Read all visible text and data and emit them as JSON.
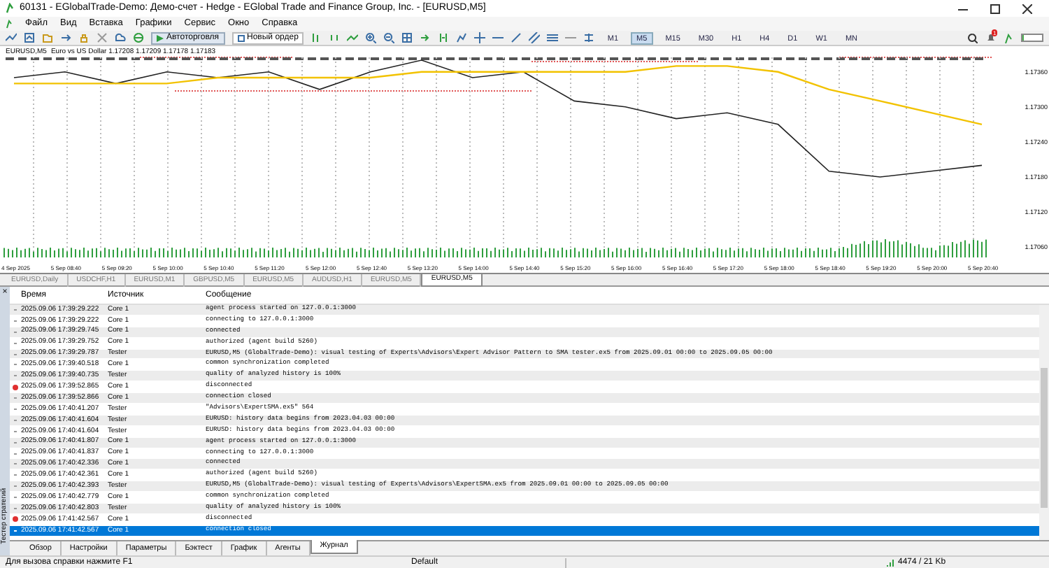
{
  "window": {
    "title": "60131 - EGlobalTrade-Demo: Демо-счет - Hedge - EGlobal Trade and Finance Group, Inc. - [EURUSD,M5]"
  },
  "menu": [
    "Файл",
    "Вид",
    "Вставка",
    "Графики",
    "Сервис",
    "Окно",
    "Справка"
  ],
  "toolbar": {
    "autotrading": "Автоторговля",
    "new_order": "Новый ордер",
    "timeframes": [
      {
        "label": "M1",
        "selected": false
      },
      {
        "label": "M5",
        "selected": true
      },
      {
        "label": "M15",
        "selected": false
      },
      {
        "label": "M30",
        "selected": false
      },
      {
        "label": "H1",
        "selected": false
      },
      {
        "label": "H4",
        "selected": false
      },
      {
        "label": "D1",
        "selected": false
      },
      {
        "label": "W1",
        "selected": false
      },
      {
        "label": "MN",
        "selected": false
      }
    ],
    "notifications": "1",
    "progress": {
      "level": 0.1
    }
  },
  "chart": {
    "header": "Euro vs US Dollar  1.17208 1.17209 1.17178 1.17183",
    "chart_data": {
      "type": "line",
      "grid": true,
      "categories": [
        "4 Sep 2025",
        "5 Sep 08:40",
        "5 Sep 09:20",
        "5 Sep 10:00",
        "5 Sep 10:40",
        "5 Sep 11:20",
        "5 Sep 12:00",
        "5 Sep 12:40",
        "5 Sep 13:20",
        "5 Sep 14:00",
        "5 Sep 14:40",
        "5 Sep 15:20",
        "5 Sep 16:00",
        "5 Sep 16:40",
        "5 Sep 17:20",
        "5 Sep 18:00",
        "5 Sep 18:40",
        "5 Sep 19:20",
        "5 Sep 20:00",
        "5 Sep 20:40"
      ],
      "ylim": [
        1.1704,
        1.1738
      ],
      "yticks": [
        {
          "value": 1.1736,
          "label": "1.17360"
        },
        {
          "value": 1.173,
          "label": "1.17300"
        },
        {
          "value": 1.1724,
          "label": "1.17240"
        },
        {
          "value": 1.1718,
          "label": "1.17180"
        },
        {
          "value": 1.1712,
          "label": "1.17120"
        },
        {
          "value": 1.1706,
          "label": "1.17060"
        }
      ],
      "series": [
        {
          "name": "EURUSD,M5",
          "color": "#222222",
          "values": [
            1.1735,
            1.1736,
            1.1734,
            1.1736,
            1.1735,
            1.1736,
            1.1733,
            1.1736,
            1.1738,
            1.1735,
            1.1736,
            1.1731,
            1.173,
            1.1728,
            1.1729,
            1.1727,
            1.1719,
            1.1718,
            1.1719,
            1.172
          ]
        },
        {
          "color": "#f2c200",
          "values": [
            1.1734,
            1.1734,
            1.1734,
            1.1734,
            1.1735,
            1.1735,
            1.1735,
            1.1735,
            1.1736,
            1.1736,
            1.1736,
            1.1736,
            1.1736,
            1.1737,
            1.1737,
            1.1736,
            1.1733,
            1.1731,
            1.1729,
            1.1727
          ]
        }
      ]
    }
  },
  "chart_tabs": [
    {
      "label": "EURUSD,Daily",
      "selected": false
    },
    {
      "label": "USDCHF,H1",
      "selected": false
    },
    {
      "label": "EURUSD,M1",
      "selected": false
    },
    {
      "label": "GBPUSD,M5",
      "selected": false
    },
    {
      "label": "EURUSD,M5",
      "selected": false
    },
    {
      "label": "AUDUSD,H1",
      "selected": false
    },
    {
      "label": "EURUSD,M5",
      "selected": false
    },
    {
      "label": "EURUSD,M5",
      "selected": true
    }
  ],
  "journal": {
    "columns": [
      "Время",
      "Источник",
      "Сообщение"
    ],
    "rows": [
      {
        "time": "2025.09.06 17:39:29.222",
        "source": "Core 1",
        "message": "agent process started on 127.0.0.1:3000",
        "kind": "info",
        "selected": false
      },
      {
        "time": "2025.09.06 17:39:29.222",
        "source": "Core 1",
        "message": "connecting to 127.0.0.1:3000",
        "kind": "info",
        "selected": false
      },
      {
        "time": "2025.09.06 17:39:29.745",
        "source": "Core 1",
        "message": "connected",
        "kind": "info",
        "selected": false
      },
      {
        "time": "2025.09.06 17:39:29.752",
        "source": "Core 1",
        "message": "authorized (agent build 5260)",
        "kind": "info",
        "selected": false
      },
      {
        "time": "2025.09.06 17:39:29.787",
        "source": "Tester",
        "message": "EURUSD,M5 (GlobalTrade-Demo): visual testing of Experts\\Advisors\\Expert Advisor Pattern to SMA tester.ex5 from 2025.09.01 00:00 to 2025.09.05 00:00",
        "kind": "info",
        "selected": false
      },
      {
        "time": "2025.09.06 17:39:40.518",
        "source": "Core 1",
        "message": "common synchronization completed",
        "kind": "info",
        "selected": false
      },
      {
        "time": "2025.09.06 17:39:40.735",
        "source": "Tester",
        "message": "quality of analyzed history is 100%",
        "kind": "info",
        "selected": false
      },
      {
        "time": "2025.09.06 17:39:52.865",
        "source": "Core 1",
        "message": "disconnected",
        "kind": "error",
        "selected": false
      },
      {
        "time": "2025.09.06 17:39:52.866",
        "source": "Core 1",
        "message": "connection closed",
        "kind": "info",
        "selected": false
      },
      {
        "time": "2025.09.06 17:40:41.207",
        "source": "Tester",
        "message": "\"Advisors\\ExpertSMA.ex5\" 564",
        "kind": "info",
        "selected": false
      },
      {
        "time": "2025.09.06 17:40:41.604",
        "source": "Tester",
        "message": "EURUSD: history data begins from 2023.04.03 00:00",
        "kind": "info",
        "selected": false
      },
      {
        "time": "2025.09.06 17:40:41.604",
        "source": "Tester",
        "message": "EURUSD: history data begins from 2023.04.03 00:00",
        "kind": "info",
        "selected": false
      },
      {
        "time": "2025.09.06 17:40:41.807",
        "source": "Core 1",
        "message": "agent process started on 127.0.0.1:3000",
        "kind": "info",
        "selected": false
      },
      {
        "time": "2025.09.06 17:40:41.837",
        "source": "Core 1",
        "message": "connecting to 127.0.0.1:3000",
        "kind": "info",
        "selected": false
      },
      {
        "time": "2025.09.06 17:40:42.336",
        "source": "Core 1",
        "message": "connected",
        "kind": "info",
        "selected": false
      },
      {
        "time": "2025.09.06 17:40:42.361",
        "source": "Core 1",
        "message": "authorized (agent build 5260)",
        "kind": "info",
        "selected": false
      },
      {
        "time": "2025.09.06 17:40:42.393",
        "source": "Tester",
        "message": "EURUSD,M5 (GlobalTrade-Demo): visual testing of Experts\\Advisors\\ExpertSMA.ex5 from 2025.09.01 00:00 to 2025.09.05 00:00",
        "kind": "info",
        "selected": false
      },
      {
        "time": "2025.09.06 17:40:42.779",
        "source": "Core 1",
        "message": "common synchronization completed",
        "kind": "info",
        "selected": false
      },
      {
        "time": "2025.09.06 17:40:42.803",
        "source": "Tester",
        "message": "quality of analyzed history is 100%",
        "kind": "info",
        "selected": false
      },
      {
        "time": "2025.09.06 17:41:42.567",
        "source": "Core 1",
        "message": "disconnected",
        "kind": "error",
        "selected": false
      },
      {
        "time": "2025.09.06 17:41:42.567",
        "source": "Core 1",
        "message": "connection closed",
        "kind": "info",
        "selected": true
      }
    ]
  },
  "side_label": "Тестер стратегий",
  "side_close": "×",
  "bottom_tabs": [
    {
      "label": "Обзор",
      "selected": false
    },
    {
      "label": "Настройки",
      "selected": false
    },
    {
      "label": "Параметры",
      "selected": false
    },
    {
      "label": "Бэктест",
      "selected": false
    },
    {
      "label": "График",
      "selected": false
    },
    {
      "label": "Агенты",
      "selected": false
    },
    {
      "label": "Журнал",
      "selected": true
    }
  ],
  "status_bar": {
    "help": "Для вызова справки нажмите F1",
    "profile": "Default",
    "traffic": "4474 / 21 Kb"
  }
}
